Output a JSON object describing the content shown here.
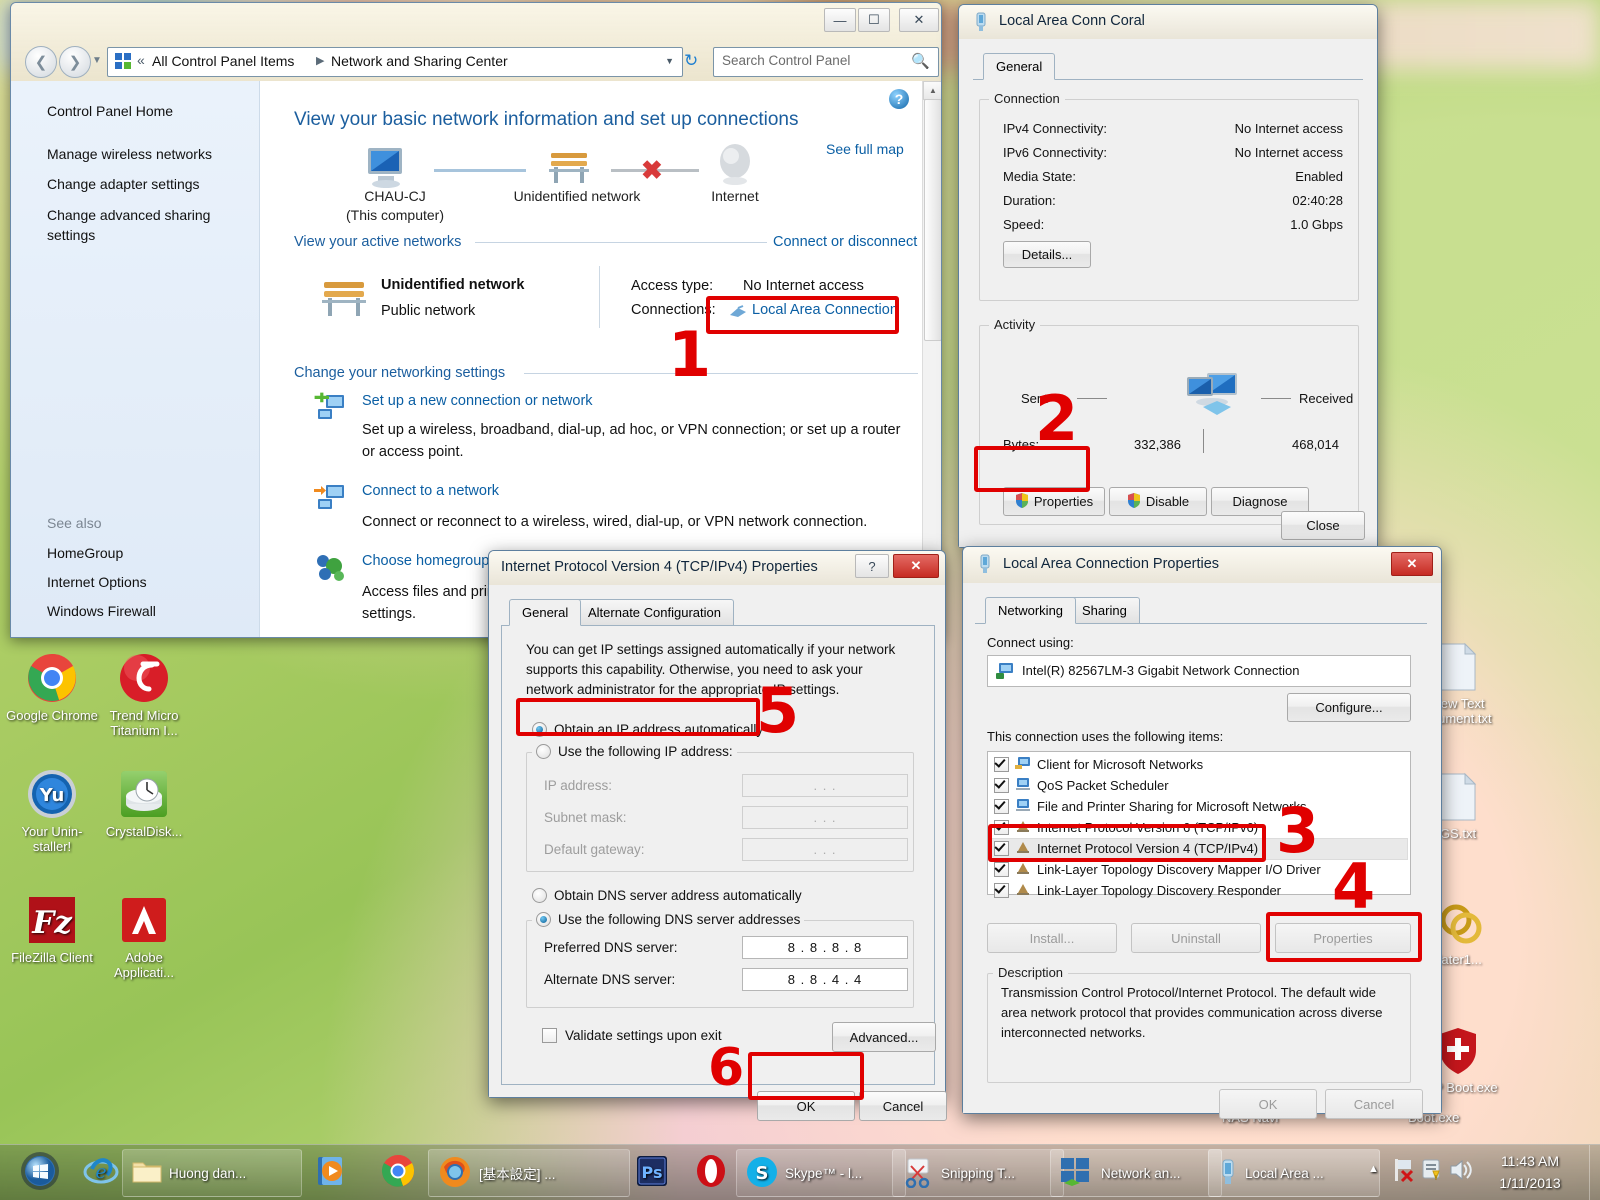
{
  "desktop": {
    "icons_left": [
      {
        "label": "Google Chrome",
        "icon": "google-chrome-icon"
      },
      {
        "label": "Trend Micro Titanium I...",
        "icon": "trend-micro-icon"
      },
      {
        "label": "Your Unin-staller!",
        "icon": "your-uninstaller-icon"
      },
      {
        "label": "CrystalDisk...",
        "icon": "crystaldiskinfo-icon"
      },
      {
        "label": "FileZilla Client",
        "icon": "filezilla-icon"
      },
      {
        "label": "Adobe Applicati...",
        "icon": "adobe-icon"
      }
    ],
    "icons_right": [
      {
        "label": "New Text ocument.txt",
        "icon": "text-file-icon"
      },
      {
        "label": "GS.txt",
        "icon": "text-file-icon"
      },
      {
        "label": "dater1...",
        "icon": "rings-icon"
      },
      {
        "label": "FTP Boot.exe",
        "icon": "swiss-shield-icon"
      }
    ],
    "labels_behind": [
      "NAS Navi",
      "Boot.exe"
    ]
  },
  "control_panel": {
    "window_title": "",
    "breadcrumb": {
      "chevron": "«",
      "parts": [
        "All Control Panel Items",
        "Network and Sharing Center"
      ]
    },
    "search_placeholder": "Search Control Panel",
    "sidebar": {
      "items": [
        "Control Panel Home",
        "Manage wireless networks",
        "Change adapter settings",
        "Change advanced sharing settings"
      ],
      "see_also_label": "See also",
      "see_also": [
        "HomeGroup",
        "Internet Options",
        "Windows Firewall"
      ]
    },
    "heading": "View your basic network information and set up connections",
    "see_full_map": "See full map",
    "map": {
      "computer_name": "CHAU-CJ",
      "computer_sub": "(This computer)",
      "network_name": "Unidentified network",
      "internet_name": "Internet"
    },
    "active_networks_header": "View your active networks",
    "connect_disconnect": "Connect or disconnect",
    "active_network": {
      "name": "Unidentified network",
      "type": "Public network",
      "access_type_label": "Access type:",
      "access_type_value": "No Internet access",
      "connections_label": "Connections:",
      "connections_value": "Local Area Connection"
    },
    "change_settings_header": "Change your networking settings",
    "tasks": [
      {
        "title": "Set up a new connection or network",
        "desc": "Set up a wireless, broadband, dial-up, ad hoc, or VPN connection; or set up a router or access point."
      },
      {
        "title": "Connect to a network",
        "desc": "Connect or reconnect to a wireless, wired, dial-up, or VPN network connection."
      },
      {
        "title": "Choose homegroup",
        "desc": "Access files and prin settings."
      }
    ]
  },
  "status_dialog": {
    "title": "Local Area Conn Coral",
    "tab": "General",
    "connection_group": "Connection",
    "rows": [
      {
        "label": "IPv4 Connectivity:",
        "value": "No Internet access"
      },
      {
        "label": "IPv6 Connectivity:",
        "value": "No Internet access"
      },
      {
        "label": "Media State:",
        "value": "Enabled"
      },
      {
        "label": "Duration:",
        "value": "02:40:28"
      },
      {
        "label": "Speed:",
        "value": "1.0 Gbps"
      }
    ],
    "details_button": "Details...",
    "activity_group": "Activity",
    "sent_label": "Sent",
    "received_label": "Received",
    "bytes_label": "Bytes:",
    "bytes_sent": "332,386",
    "bytes_received": "468,014",
    "properties_button": "Properties",
    "disable_button": "Disable",
    "diagnose_button": "Diagnose",
    "close_button": "Close"
  },
  "lac_properties": {
    "title": "Local Area Connection Properties",
    "tabs": [
      "Networking",
      "Sharing"
    ],
    "connect_using_label": "Connect using:",
    "adapter": "Intel(R) 82567LM-3 Gigabit Network Connection",
    "configure_button": "Configure...",
    "items_label": "This connection uses the following items:",
    "items": [
      {
        "label": "Client for Microsoft Networks",
        "checked": true,
        "selected": false
      },
      {
        "label": "QoS Packet Scheduler",
        "checked": true,
        "selected": false
      },
      {
        "label": "File and Printer Sharing for Microsoft Networks",
        "checked": true,
        "selected": false
      },
      {
        "label": "Internet Protocol Version 6 (TCP/IPv6)",
        "checked": true,
        "selected": false
      },
      {
        "label": "Internet Protocol Version 4 (TCP/IPv4)",
        "checked": true,
        "selected": true
      },
      {
        "label": "Link-Layer Topology Discovery Mapper I/O Driver",
        "checked": true,
        "selected": false
      },
      {
        "label": "Link-Layer Topology Discovery Responder",
        "checked": true,
        "selected": false
      }
    ],
    "install_button": "Install...",
    "uninstall_button": "Uninstall",
    "properties_button": "Properties",
    "description_group": "Description",
    "description": "Transmission Control Protocol/Internet Protocol. The default wide area network protocol that provides communication across diverse interconnected networks.",
    "ok_button": "OK",
    "cancel_button": "Cancel"
  },
  "ipv4_dialog": {
    "title": "Internet Protocol Version 4 (TCP/IPv4) Properties",
    "tabs": [
      "General",
      "Alternate Configuration"
    ],
    "intro": "You can get IP settings assigned automatically if your network supports this capability. Otherwise, you need to ask your network administrator for the appropriate IP settings.",
    "obtain_ip_auto": "Obtain an IP address automatically",
    "use_following_ip": "Use the following IP address:",
    "ip_fields": [
      {
        "label": "IP address:",
        "value": ".   .   ."
      },
      {
        "label": "Subnet mask:",
        "value": ".   .   ."
      },
      {
        "label": "Default gateway:",
        "value": ".   .   ."
      }
    ],
    "obtain_dns_auto": "Obtain DNS server address automatically",
    "use_following_dns": "Use the following DNS server addresses",
    "dns_fields": [
      {
        "label": "Preferred DNS server:",
        "value": "8 . 8 . 8 . 8"
      },
      {
        "label": "Alternate DNS server:",
        "value": "8 . 8 . 4 . 4"
      }
    ],
    "validate_label": "Validate settings upon exit",
    "advanced_button": "Advanced...",
    "ok_button": "OK",
    "cancel_button": "Cancel",
    "selected_ip_mode": "auto",
    "selected_dns_mode": "manual",
    "validate_checked": false
  },
  "annotations": [
    {
      "number": "1"
    },
    {
      "number": "2"
    },
    {
      "number": "3"
    },
    {
      "number": "4"
    },
    {
      "number": "5"
    },
    {
      "number": "6"
    }
  ],
  "taskbar": {
    "items": [
      {
        "label": "",
        "icon": "start-orb-icon"
      },
      {
        "label": "",
        "icon": "internet-explorer-icon"
      },
      {
        "label": "Huong dan...",
        "icon": "folder-icon"
      },
      {
        "label": "",
        "icon": "windows-media-player-icon"
      },
      {
        "label": "",
        "icon": "chrome-icon"
      },
      {
        "label": "[基本設定] ...",
        "icon": "firefox-icon"
      },
      {
        "label": "",
        "icon": "photoshop-icon"
      },
      {
        "label": "",
        "icon": "opera-icon"
      },
      {
        "label": "Skype™ - l...",
        "icon": "skype-icon"
      },
      {
        "label": "Snipping T...",
        "icon": "snipping-tool-icon"
      },
      {
        "label": "Network an...",
        "icon": "network-icon"
      },
      {
        "label": "Local Area ...",
        "icon": "lan-status-icon"
      }
    ],
    "tray": {
      "show_hidden": "▲",
      "icons": [
        "network-flag-icon",
        "action-center-icon",
        "volume-icon"
      ],
      "time": "11:43 AM",
      "date": "1/11/2013"
    }
  },
  "colors": {
    "accent_link": "#0b5fa4",
    "annotation_red": "#e00000",
    "heading_blue": "#1b5e9e",
    "desktop_green": "#9dbd5a"
  }
}
